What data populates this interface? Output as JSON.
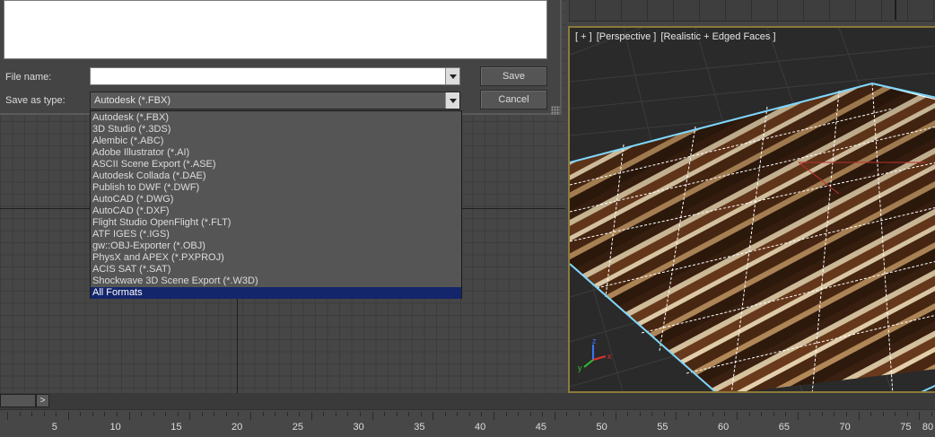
{
  "dialog": {
    "file_name_label": "File name:",
    "file_name_value": "",
    "save_as_type_label": "Save as type:",
    "save_as_type_value": "Autodesk (*.FBX)",
    "save_label": "Save",
    "cancel_label": "Cancel"
  },
  "dropdown": {
    "items": [
      "Autodesk (*.FBX)",
      "3D Studio (*.3DS)",
      "Alembic (*.ABC)",
      "Adobe Illustrator (*.AI)",
      "ASCII Scene Export (*.ASE)",
      "Autodesk Collada (*.DAE)",
      "Publish to DWF (*.DWF)",
      "AutoCAD (*.DWG)",
      "AutoCAD (*.DXF)",
      "Flight Studio OpenFlight (*.FLT)",
      "ATF IGES (*.IGS)",
      "gw::OBJ-Exporter (*.OBJ)",
      "PhysX and APEX (*.PXPROJ)",
      "ACIS SAT (*.SAT)",
      "Shockwave 3D Scene Export (*.W3D)",
      "All Formats"
    ],
    "selected": "All Formats"
  },
  "viewport": {
    "label_parts": [
      "[ + ]",
      "[Perspective ]",
      "[Realistic + Edged Faces ]"
    ],
    "axis_labels": {
      "x": "x",
      "y": "y",
      "z": "z"
    }
  },
  "timeline": {
    "next_label": ">",
    "ticks": [
      "5",
      "10",
      "15",
      "20",
      "25",
      "30",
      "35",
      "40",
      "45",
      "50",
      "55",
      "60",
      "65",
      "70",
      "75",
      "80"
    ]
  },
  "colors": {
    "selection": "#14266b",
    "viewport_border": "#8c7a3c",
    "selection_outline": "#7fd8ff"
  }
}
